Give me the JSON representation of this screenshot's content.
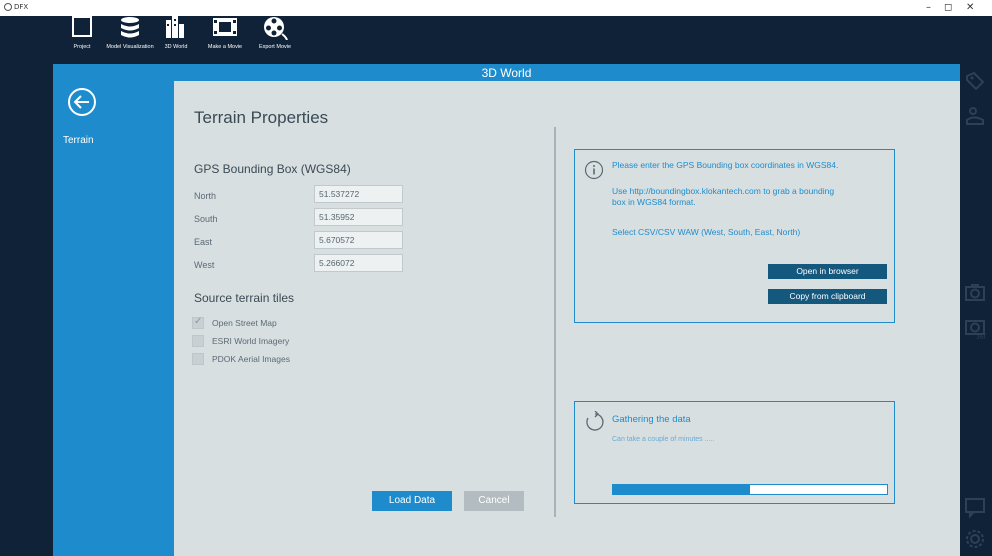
{
  "window": {
    "app_title": "DFX",
    "controls": {
      "minimize": "–",
      "maximize": "◻",
      "close": "✕"
    }
  },
  "toolbar": {
    "items": [
      {
        "label": "Project",
        "icon": "square-icon"
      },
      {
        "label": "Model Visualization",
        "icon": "database-icon"
      },
      {
        "label": "3D World",
        "icon": "city-icon"
      },
      {
        "label": "Make a Movie",
        "icon": "film-icon"
      },
      {
        "label": "Export Movie",
        "icon": "film-reel-icon"
      }
    ]
  },
  "header": {
    "title": "3D World"
  },
  "sidebar": {
    "back_icon": "back-arrow-icon",
    "items": [
      {
        "label": "Terrain"
      }
    ]
  },
  "terrain": {
    "title": "Terrain Properties",
    "bbox_title": "GPS Bounding Box (WGS84)",
    "fields": [
      {
        "label": "North",
        "value": "51.537272"
      },
      {
        "label": "South",
        "value": "51.35952"
      },
      {
        "label": "East",
        "value": "5.670572"
      },
      {
        "label": "West",
        "value": "5.266072"
      }
    ],
    "tiles_title": "Source terrain tiles",
    "tiles": [
      {
        "label": "Open Street Map",
        "checked": true
      },
      {
        "label": "ESRI World Imagery",
        "checked": false
      },
      {
        "label": "PDOK Aerial Images",
        "checked": false
      }
    ],
    "load_label": "Load Data",
    "cancel_label": "Cancel"
  },
  "info": {
    "line1": "Please enter the GPS Bounding box coordinates in WGS84.",
    "line2a": "Use http://boundingbox.klokantech.com to grab a bounding",
    "line2b": "box in WGS84 format.",
    "line3": "Select CSV/CSV WAW (West, South, East, North)",
    "open_browser_label": "Open in browser",
    "copy_clipboard_label": "Copy from clipboard"
  },
  "progress": {
    "title": "Gathering the data",
    "subtitle": "Can take a couple of minutes .....",
    "value": 0.5
  },
  "right_sidebar": {
    "icons": [
      "tag-icon",
      "walker-icon",
      "camera-icon",
      "camera-360-icon",
      "chat-icon",
      "settings-icon"
    ]
  },
  "colors": {
    "accent": "#1e8ccc",
    "dark": "#0f2238",
    "content_bg": "#d8dfe1",
    "button_dark": "#15587e"
  }
}
